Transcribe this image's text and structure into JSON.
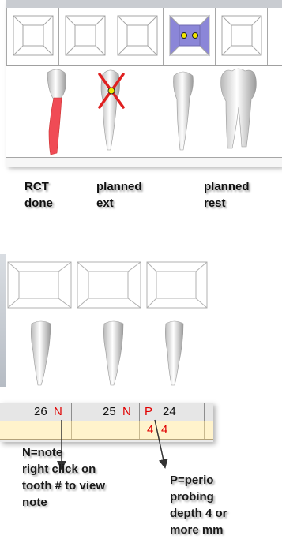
{
  "legend": {
    "rct": "RCT\ndone",
    "ext": "planned\next",
    "rest": "planned\nrest"
  },
  "teeth_top": [
    {
      "status": "RCT done",
      "root_fill_color": "#f04b55"
    },
    {
      "status": "planned ext",
      "mark_color": "#e02020"
    },
    {
      "status": "normal"
    },
    {
      "status": "planned rest",
      "surface_color": "#8b86d8"
    }
  ],
  "table": {
    "col1_num": "26",
    "col1_flag": "N",
    "col2_num": "25",
    "col2_flag": "N",
    "col3_flag": "P",
    "col3_num": "24",
    "depth1": "4",
    "depth2": "4"
  },
  "annotations": {
    "note": "N=note\nright click on\ntooth # to view\nnote",
    "perio": "P=perio\nprobing\ndepth 4 or\nmore mm"
  },
  "colors": {
    "flag_red": "#e00000",
    "row_highlight": "#fff3cc",
    "planned_rest": "#8b86d8",
    "rct_fill": "#f04b55"
  }
}
